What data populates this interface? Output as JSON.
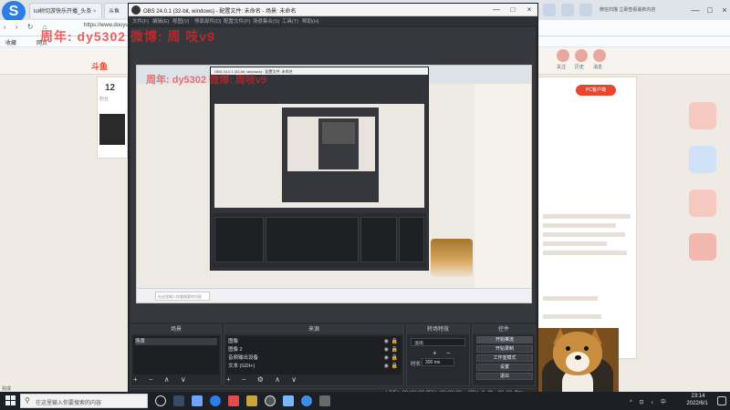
{
  "browser": {
    "tabs": [
      {
        "label": "lol树切游快乐开播_头条",
        "close": "×"
      },
      {
        "label": "斗鱼"
      }
    ],
    "url": "https://www.douyu.com/...",
    "bookmarks": [
      "收藏",
      "网页"
    ],
    "top_right_text": "微信扫描 立即查看最新内容",
    "window_controls": {
      "minimize": "—",
      "maximize": "□",
      "close": "×"
    },
    "status": "完成"
  },
  "site": {
    "logo": "斗鱼",
    "count": "12",
    "count_label": "粉丝",
    "right_button": "PC客户端",
    "icon_labels": [
      "关注",
      "历史",
      "消息"
    ]
  },
  "watermark": {
    "line1": "周年:  dy5302   微博:  周  吱v9",
    "line2": "周年:  dy5302   微博:  周吱v9"
  },
  "obs": {
    "title": "OBS 24.0.1 (32-bit, windows) - 配置文件: 未命名 - 场景: 未命名",
    "window_controls": {
      "minimize": "—",
      "maximize": "□",
      "close": "×"
    },
    "menu": [
      "文件(F)",
      "编辑(E)",
      "视图(V)",
      "停靠部件(D)",
      "配置文件(P)",
      "场景集合(S)",
      "工具(T)",
      "帮助(H)"
    ],
    "nested_title": "OBS 24.0.1 (32-bit, windows) - 配置文件: 未命名",
    "taskbar_search": "在这里输入你要搜索的内容",
    "docks": {
      "scenes": {
        "header": "场景",
        "items": [
          "场景"
        ],
        "toolbar": "+ − ∧ ∨"
      },
      "sources": {
        "header": "来源",
        "items": [
          "图像",
          "图像 2",
          "音频输出设备",
          "文本 (GDI+)"
        ],
        "eye_icon": "◉",
        "lock_icon": "🔒",
        "toolbar": "+ − ⚙ ∧ ∨"
      },
      "transitions": {
        "header": "转场特效",
        "selected": "淡出",
        "tools": "+ − ⚙",
        "duration_label": "时长",
        "duration_value": "300 ms"
      },
      "controls": {
        "header": "控件",
        "buttons": [
          "开始推流",
          "开始录制",
          "工作室模式",
          "设置",
          "退出"
        ]
      }
    },
    "status": {
      "live": "LIVE: 00:00:00",
      "rec": "REC: 00:00:00",
      "cpu": "CPU: 0.4%, 60.00 fps"
    }
  },
  "taskbar": {
    "search_placeholder": "在这里输入你要搜索的内容",
    "tray": "^ ⊡ ♪ 中",
    "time": "23:14",
    "date": "2022/6/1"
  },
  "colors": {
    "obs_bg": "#2b2d31",
    "accent": "#e8472b",
    "watermark": "#e22828",
    "taskbar": "#1c1f26"
  }
}
